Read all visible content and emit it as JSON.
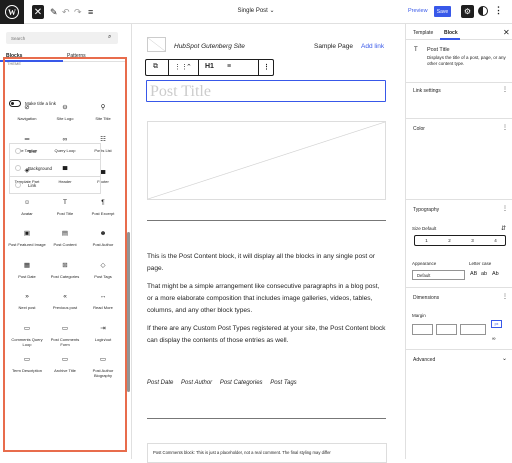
{
  "topbar": {
    "add_label": "✕",
    "edit_icon": "✎",
    "undo_icon": "↶",
    "redo_icon": "↷",
    "list_view_icon": "≡",
    "document_title": "Single Post",
    "title_chevron": "⌄",
    "preview_label": "Preview",
    "save_label": "Save",
    "settings_icon": "⚙",
    "more_icon": "⋮"
  },
  "inserter": {
    "search_placeholder": "Search",
    "search_icon": "⌕",
    "tabs": [
      "Blocks",
      "Patterns"
    ],
    "category": "THEME",
    "blocks": [
      {
        "label": "Navigation",
        "icon": "⊘"
      },
      {
        "label": "Site Logo",
        "icon": "⊖"
      },
      {
        "label": "Site Title",
        "icon": "⚲"
      },
      {
        "label": "Site Tagline",
        "icon": "═"
      },
      {
        "label": "Query Loop",
        "icon": "∞"
      },
      {
        "label": "Posts List",
        "icon": "☷"
      },
      {
        "label": "Template Part",
        "icon": "◈"
      },
      {
        "label": "Header",
        "icon": "▀"
      },
      {
        "label": "Footer",
        "icon": "▄"
      },
      {
        "label": "Avatar",
        "icon": "☺"
      },
      {
        "label": "Post Title",
        "icon": "T"
      },
      {
        "label": "Post Excerpt",
        "icon": "¶"
      },
      {
        "label": "Post Featured Image",
        "icon": "▣"
      },
      {
        "label": "Post Content",
        "icon": "▤"
      },
      {
        "label": "Post Author",
        "icon": "☻"
      },
      {
        "label": "Post Date",
        "icon": "▦"
      },
      {
        "label": "Post Categories",
        "icon": "⊞"
      },
      {
        "label": "Post Tags",
        "icon": "◇"
      },
      {
        "label": "Next post",
        "icon": "»"
      },
      {
        "label": "Previous post",
        "icon": "«"
      },
      {
        "label": "Read More",
        "icon": "↔"
      },
      {
        "label": "Comments Query Loop",
        "icon": "▭"
      },
      {
        "label": "Post Comments Form",
        "icon": "▭"
      },
      {
        "label": "Login/out",
        "icon": "⇥"
      },
      {
        "label": "Term Description",
        "icon": "▭"
      },
      {
        "label": "Archive Title",
        "icon": "▭"
      },
      {
        "label": "Post Author Biography",
        "icon": "▭"
      }
    ]
  },
  "canvas": {
    "site_title": "HubSpot Gutenberg Site",
    "nav_items": [
      "Sample Page",
      "Add link"
    ],
    "toolbar_icons": [
      "⧉",
      "⋮⋮",
      "⌃",
      "H1",
      "≡",
      "⋮"
    ],
    "post_title_placeholder": "Post Title",
    "content_paragraphs": [
      "This is the Post Content block, it will display all the blocks in any single post or page.",
      "That might be a simple arrangement like consecutive paragraphs in a blog post, or a more elaborate composition that includes image galleries, videos, tables, columns, and any other block types.",
      "If there are any Custom Post Types registered at your site, the Post Content block can display the contents of those entries as well."
    ],
    "meta": [
      "Post Date",
      "Post Author",
      "Post Categories",
      "Post Tags"
    ],
    "comments_notice": "Post Comments block: This is just a placeholder, not a real comment. The final styling may differ"
  },
  "sidebar": {
    "tabs": [
      "Template",
      "Block"
    ],
    "close_icon": "✕",
    "block_icon": "T",
    "block_name": "Post Title",
    "block_description": "Displays the title of a post, page, or any other content type.",
    "link_settings_title": "Link settings",
    "make_link_label": "Make title a link",
    "color_title": "Color",
    "color_options": [
      "Text",
      "Background",
      "Link"
    ],
    "typography_title": "Typography",
    "size_label": "Size Default",
    "size_adjust_icon": "⇵",
    "size_steps": [
      "1",
      "2",
      "3",
      "4"
    ],
    "appearance_label": "Appearance",
    "appearance_value": "Default",
    "letter_case_label": "Letter case",
    "letter_case_options": [
      "AB",
      "ab",
      "Ab"
    ],
    "dimensions_title": "Dimensions",
    "margin_label": "Margin",
    "unit_label": "px",
    "advanced_title": "Advanced",
    "section_menu_icon": "⋮",
    "chevron_icon": "⌄"
  }
}
